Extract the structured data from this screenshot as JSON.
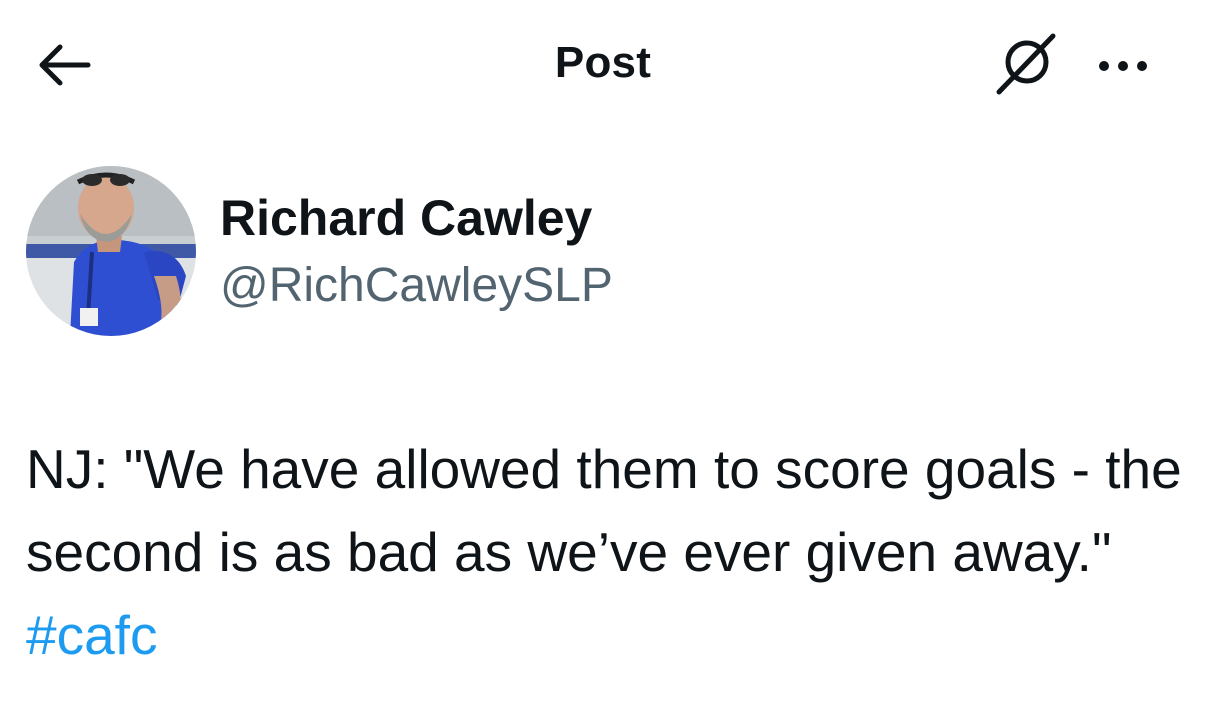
{
  "header": {
    "title": "Post",
    "back_icon": "arrow-left-icon",
    "grok_icon": "grok-icon",
    "more_icon": "more-horizontal-icon"
  },
  "author": {
    "display_name": "Richard Cawley",
    "handle": "@RichCawleySLP"
  },
  "post": {
    "text": "NJ:  \"We have allowed them to score goals - the second is as bad as we’ve ever given away.\"",
    "hashtag": "#cafc"
  },
  "colors": {
    "text_primary": "#0f1419",
    "text_secondary": "#536471",
    "link": "#1d9bf0"
  }
}
